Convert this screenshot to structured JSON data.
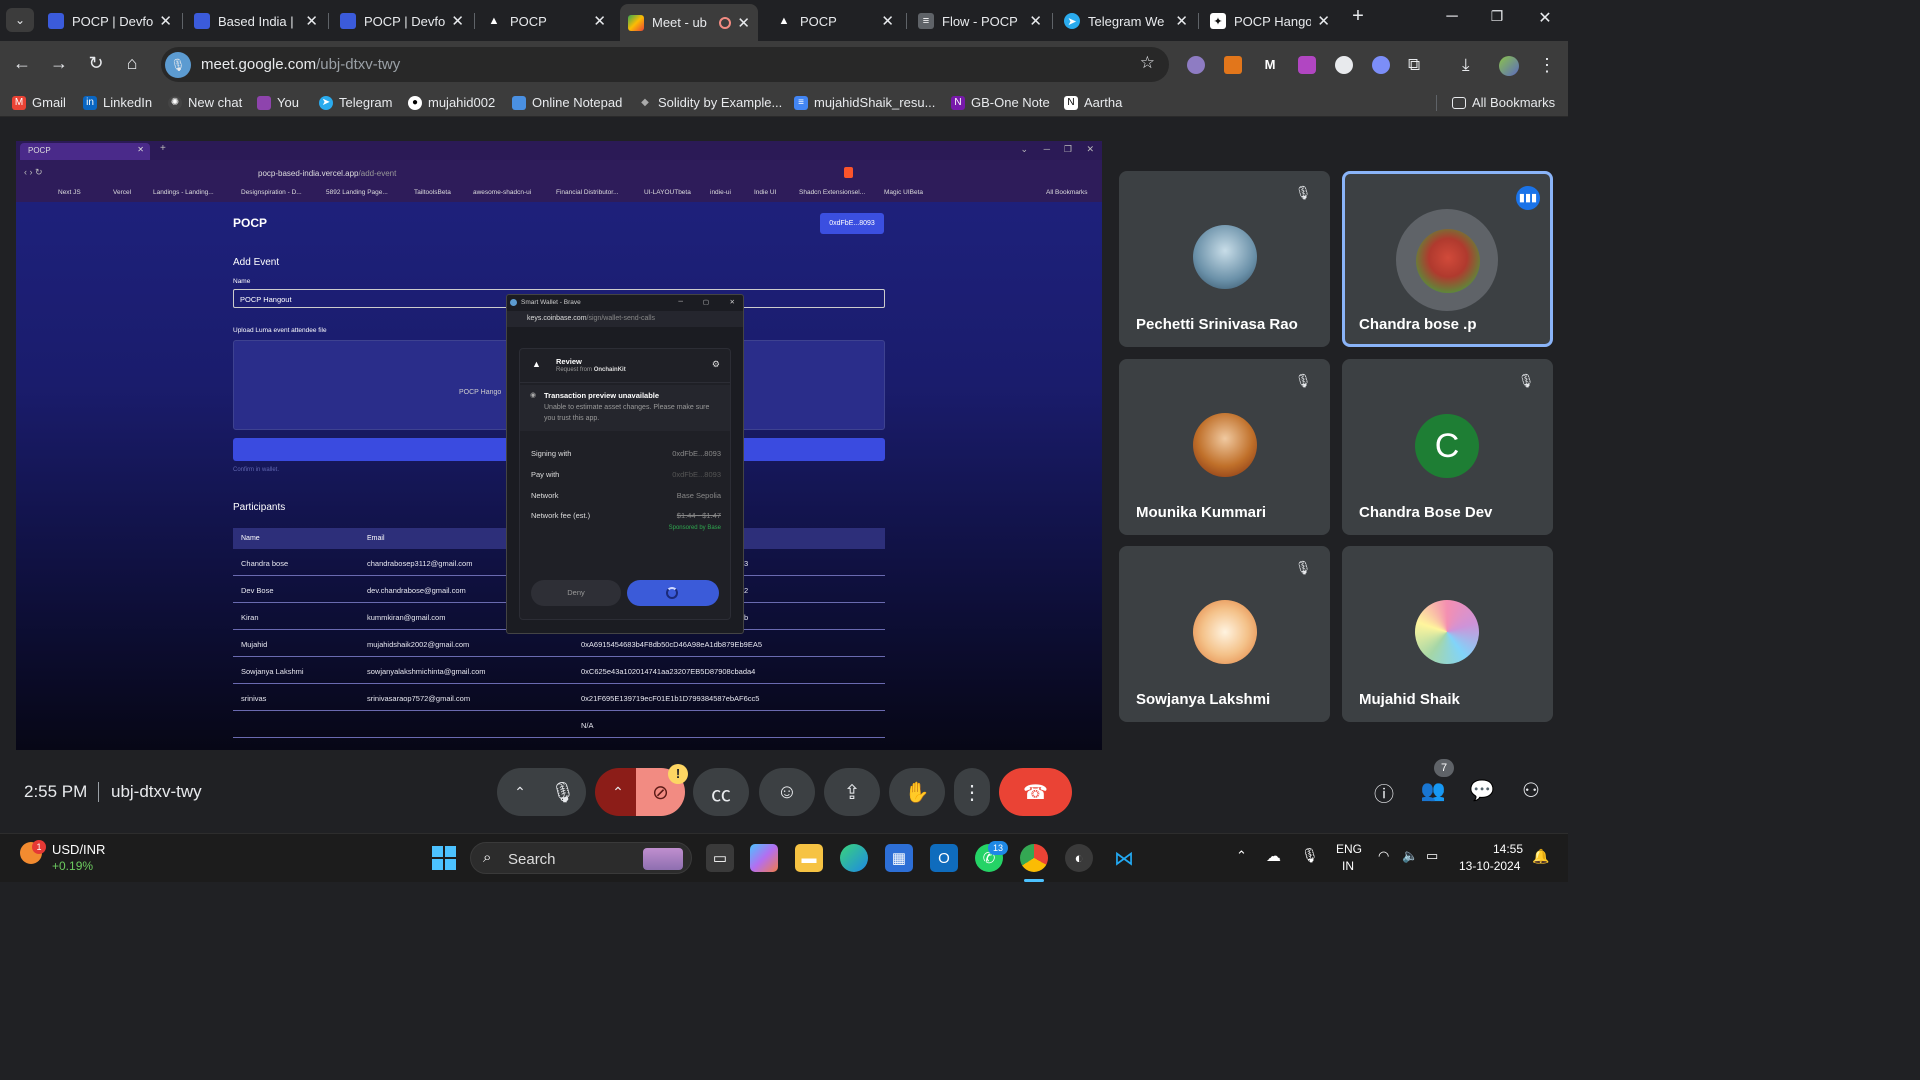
{
  "tabs": [
    {
      "title": "POCP | Devfo",
      "favicon": "doc-icon"
    },
    {
      "title": "Based India |",
      "favicon": "doc-icon"
    },
    {
      "title": "POCP | Devfo",
      "favicon": "doc-icon"
    },
    {
      "title": "POCP",
      "favicon": "triangle-icon"
    },
    {
      "title": "Meet - ub",
      "favicon": "meet-icon"
    },
    {
      "title": "POCP",
      "favicon": "triangle-icon"
    },
    {
      "title": "Flow - POCP",
      "favicon": "layers-icon"
    },
    {
      "title": "Telegram We",
      "favicon": "telegram-icon"
    },
    {
      "title": "POCP Hango",
      "favicon": "sparkle-icon"
    }
  ],
  "address": {
    "host": "meet.google.com",
    "path": "/ubj-dtxv-twy"
  },
  "bookmarks": [
    "Gmail",
    "LinkedIn",
    "New chat",
    "You",
    "Telegram",
    "mujahid002",
    "Online Notepad",
    "Solidity by Example...",
    "mujahidShaik_resu...",
    "GB-One Note",
    "Aartha"
  ],
  "all_bookmarks": "All Bookmarks",
  "shared": {
    "tab_title": "POCP",
    "url_host": "pocp-based-india.vercel.app",
    "url_path": "/add-event",
    "bookmarks": [
      "Next JS",
      "Vercel",
      "Landings - Landing...",
      "Designspiration - D...",
      "5892 Landing Page...",
      "TailtoolsBeta",
      "awesome-shadcn-ui",
      "Financial Distributor...",
      "UI-LAYOUTbeta",
      "indie-ui",
      "Indie UI",
      "Shadcn Extensionsel...",
      "Magic UIBeta"
    ],
    "bookmarks_all": "All Bookmarks",
    "app_title": "POCP",
    "wallet_btn": "0xdFbE...8093",
    "add_event": "Add Event",
    "name_label": "Name",
    "name_value": "POCP Hangout",
    "upload_label": "Upload Luma event attendee file",
    "upload_file": "POCP Hango",
    "confirm_text": "Confirm in wallet.",
    "participants": "Participants",
    "col_name": "Name",
    "col_email": "Email",
    "rows": [
      {
        "name": "Chandra bose",
        "email": "chandrabosep3112@gmail.com",
        "addr": "3"
      },
      {
        "name": "Dev Bose",
        "email": "dev.chandrabose@gmail.com",
        "addr": "2"
      },
      {
        "name": "Kiran",
        "email": "kummkiran@gmail.com",
        "addr": "b"
      },
      {
        "name": "Mujahid",
        "email": "mujahidshaik2002@gmail.com",
        "addr": "0xA6915454683b4F8db50cD46A98eA1db879Eb9EA5"
      },
      {
        "name": "Sowjanya Lakshmi",
        "email": "sowjanyalakshmichinta@gmail.com",
        "addr": "0xC625e43a102014741aa23207EB5D87908cbada4"
      },
      {
        "name": "srinivas",
        "email": "srinivasaraop7572@gmail.com",
        "addr": "0x21F695E139719ecF01E1b1D799384587ebAF6cc5"
      },
      {
        "name": "",
        "email": "",
        "addr": "N/A"
      }
    ]
  },
  "wallet": {
    "window_title": "Smart Wallet - Brave",
    "url_host": "keys.coinbase.com",
    "url_path": "/sign/wallet-send-calls",
    "review": "Review",
    "request_from_prefix": "Request from",
    "request_from": "OnchainKit",
    "preview_title": "Transaction preview unavailable",
    "preview_desc": "Unable to estimate asset changes. Please make sure you trust this app.",
    "signing_with_label": "Signing with",
    "signing_with": "0xdFbE...8093",
    "pay_with_label": "Pay with",
    "pay_with": "0xdFbE...8093",
    "network_label": "Network",
    "network": "Base Sepolia",
    "fee_label": "Network fee (est.)",
    "fee": "$1.44 - $1.47",
    "sponsored": "Sponsored by Base",
    "deny": "Deny"
  },
  "participants": [
    {
      "name": "Pechetti Srinivasa Rao",
      "muted": true
    },
    {
      "name": "Chandra bose .p",
      "muted": false,
      "speaking": true
    },
    {
      "name": "Mounika Kummari",
      "muted": true
    },
    {
      "name": "Chandra Bose Dev",
      "muted": true,
      "initial": "C"
    },
    {
      "name": "Sowjanya Lakshmi",
      "muted": true
    },
    {
      "name": "Mujahid Shaik",
      "muted": false
    }
  ],
  "meeting": {
    "time": "2:55 PM",
    "code": "ubj-dtxv-twy",
    "people_count": "7"
  },
  "taskbar": {
    "ticker": "USD/INR",
    "change": "+0.19%",
    "notif_count": "1",
    "search": "Search",
    "whatsapp_badge": "13",
    "lang1": "ENG",
    "lang2": "IN",
    "clock": "14:55",
    "date": "13-10-2024"
  },
  "colors": {
    "accent": "#8ab4f8",
    "end_call": "#ea4335",
    "cam_off": "#f28b82"
  }
}
